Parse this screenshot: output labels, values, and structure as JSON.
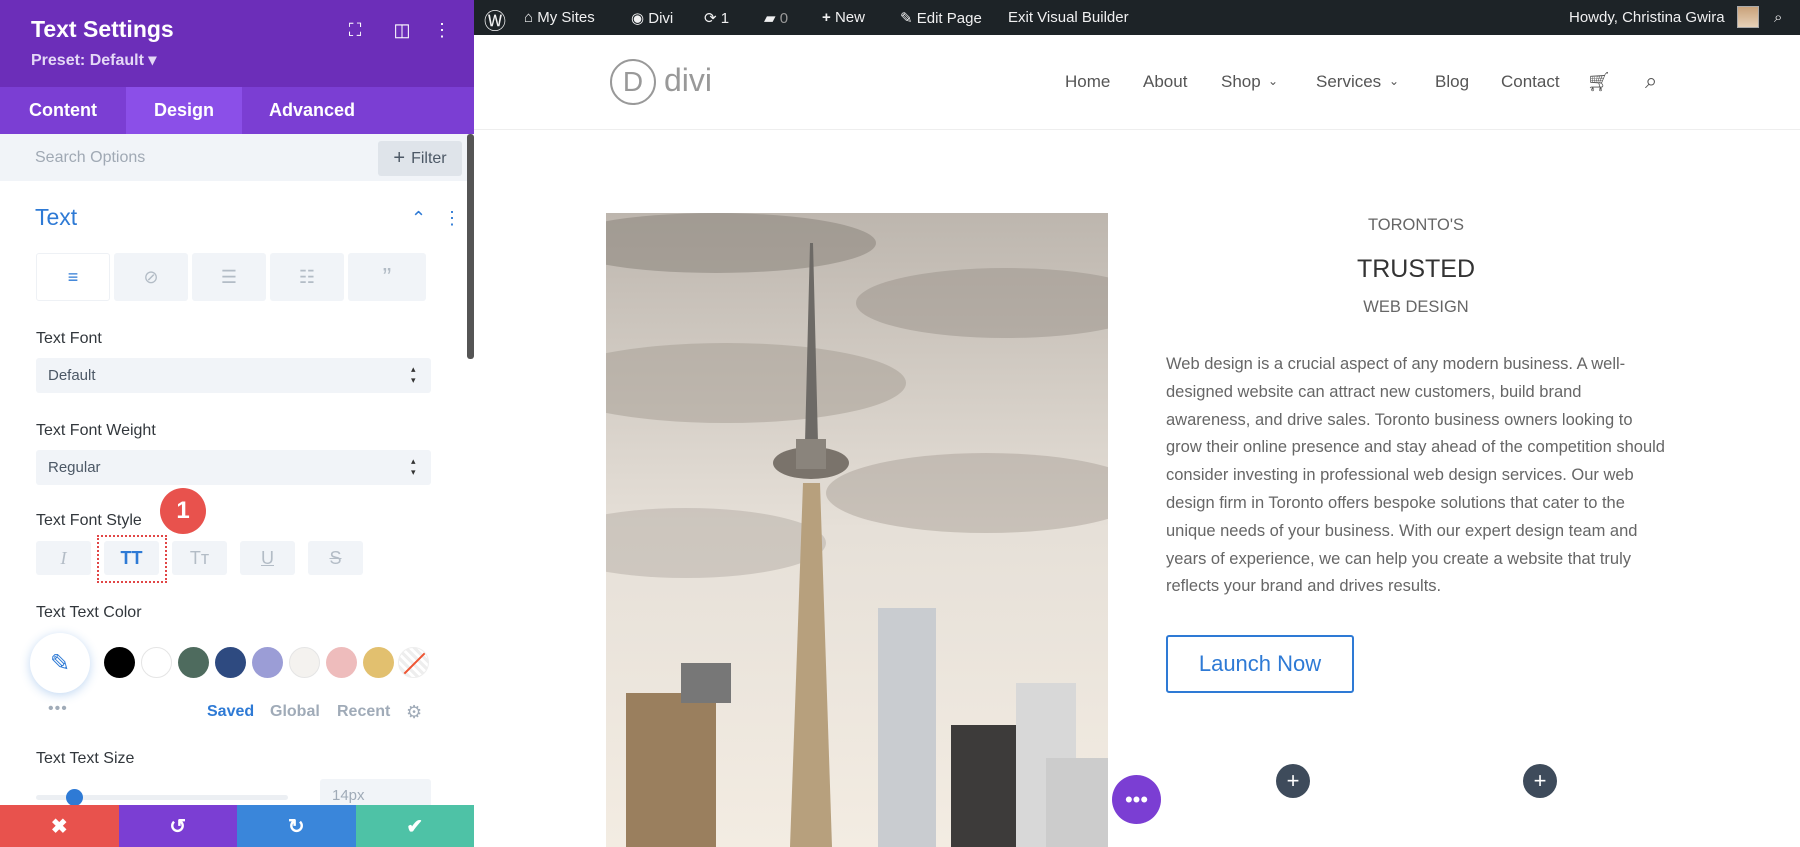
{
  "panel": {
    "title": "Text Settings",
    "preset": "Preset: Default ▾",
    "tabs": [
      "Content",
      "Design",
      "Advanced"
    ],
    "search_placeholder": "Search Options",
    "filter_label": "Filter",
    "section_title": "Text",
    "text_font_label": "Text Font",
    "text_font_value": "Default",
    "weight_label": "Text Font Weight",
    "weight_value": "Regular",
    "style_label": "Text Font Style",
    "style_buttons": [
      "I",
      "TT",
      "Tт",
      "U",
      "S"
    ],
    "badge": "1",
    "color_label": "Text Text Color",
    "swatches": [
      "#000000",
      "#ffffff",
      "#4e6b5e",
      "#2e4a80",
      "#9b9dd6",
      "#f4f2ef",
      "#eebcbc",
      "#e2c06f"
    ],
    "color_tabs": [
      "Saved",
      "Global",
      "Recent"
    ],
    "size_label": "Text Text Size",
    "size_value": "14px",
    "size_slider_fraction": 0.15
  },
  "wpbar": {
    "my_sites": "My Sites",
    "site": "Divi",
    "updates": "1",
    "comments": "0",
    "new": "New",
    "edit": "Edit Page",
    "exit": "Exit Visual Builder",
    "howdy": "Howdy, Christina Gwira"
  },
  "site": {
    "logo": "divi",
    "nav": [
      "Home",
      "About",
      "Shop",
      "Services",
      "Blog",
      "Contact"
    ],
    "kicker": "TORONTO'S",
    "heading": "TRUSTED",
    "subheading": "WEB DESIGN",
    "body": "Web design is a crucial aspect of any modern business. A well-designed website can attract new customers, build brand awareness, and drive sales. Toronto business owners looking to grow their online presence and stay ahead of the competition should consider investing in professional web design services. Our web design firm in Toronto offers bespoke solutions that cater to the unique needs of your business. With our expert design team and years of experience, we can help you create a website that truly reflects your brand and drives results.",
    "button": "Launch Now"
  },
  "colors": {
    "accent": "#2e7ad5",
    "purple": "#6c2eb9",
    "cancel": "#e8524d",
    "undo": "#7b3ed3",
    "redo": "#3a86da",
    "save": "#4ec2a6"
  }
}
